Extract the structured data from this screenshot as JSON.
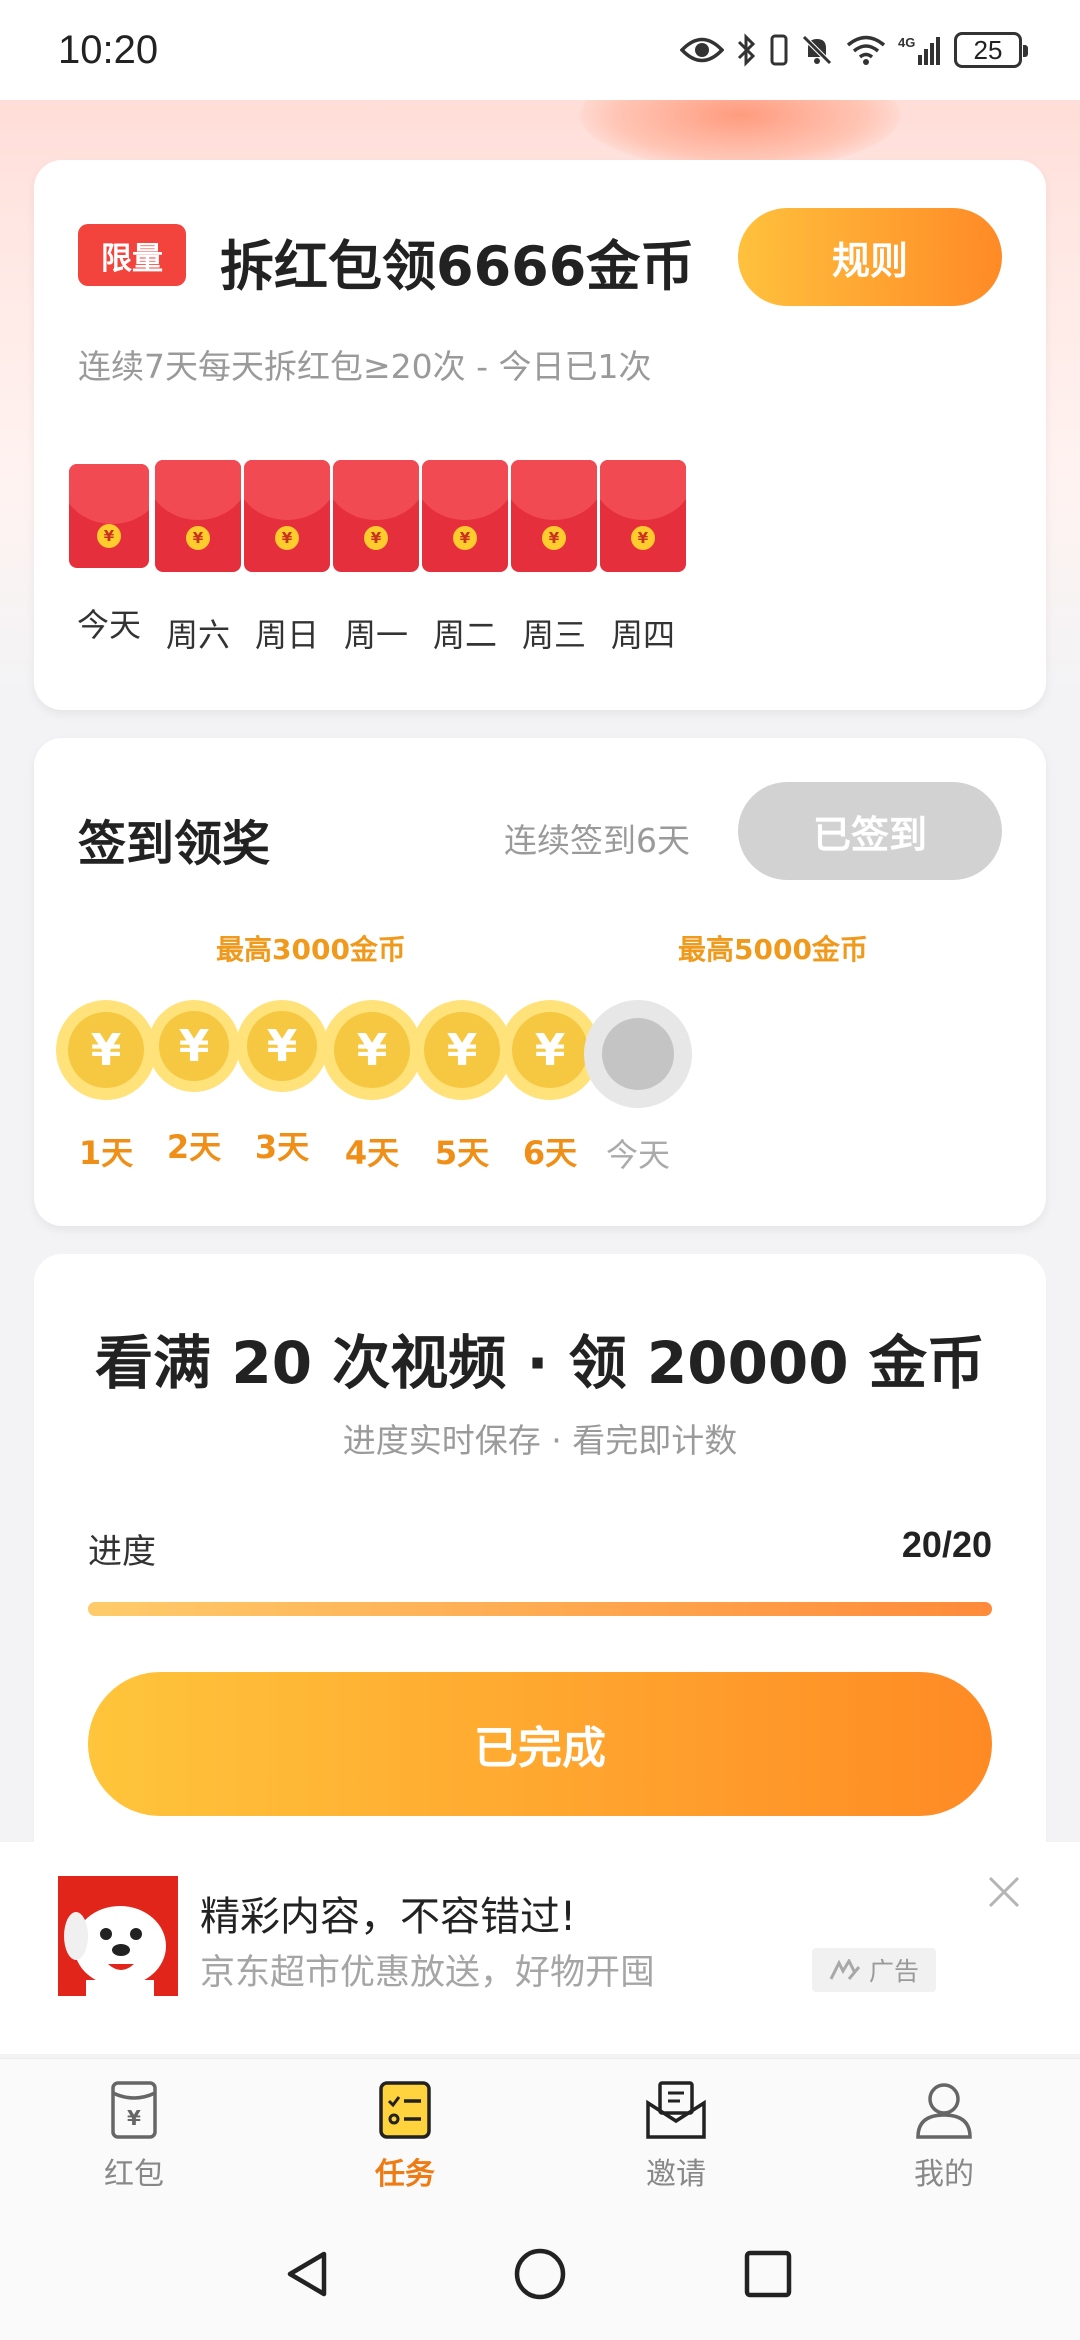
{
  "status_bar": {
    "time": "10:20",
    "battery": "25",
    "network": "4G"
  },
  "red_packet_task": {
    "badge": "限量",
    "title": "拆红包领6666金币",
    "rule_button": "规则",
    "subtitle": "连续7天每天拆红包≥20次 - 今日已1次",
    "days": [
      {
        "label": "今天"
      },
      {
        "label": "周六"
      },
      {
        "label": "周日"
      },
      {
        "label": "周一"
      },
      {
        "label": "周二"
      },
      {
        "label": "周三"
      },
      {
        "label": "周四"
      }
    ],
    "coin_symbol": "¥"
  },
  "check_in": {
    "title": "签到领奖",
    "streak": "连续签到6天",
    "button": "已签到",
    "max_labels": [
      "最高3000金币",
      "最高5000金币"
    ],
    "coin_symbol": "¥",
    "days": [
      {
        "label": "1天",
        "done": true
      },
      {
        "label": "2天",
        "done": true
      },
      {
        "label": "3天",
        "done": true
      },
      {
        "label": "4天",
        "done": true
      },
      {
        "label": "5天",
        "done": true
      },
      {
        "label": "6天",
        "done": true
      },
      {
        "label": "今天",
        "done": false
      }
    ]
  },
  "video_task": {
    "title": "看满 20 次视频 · 领 20000 金币",
    "subtitle": "进度实时保存 · 看完即计数",
    "progress_label": "进度",
    "progress_text": "20/20",
    "progress_fraction": 1.0,
    "button": "已完成"
  },
  "ad": {
    "title": "精彩内容，不容错过!",
    "description": "京东超市优惠放送，好物开囤",
    "tag": "广告"
  },
  "bottom_nav": {
    "items": [
      {
        "label": "红包",
        "icon": "red-packet-icon",
        "active": false
      },
      {
        "label": "任务",
        "icon": "task-list-icon",
        "active": true
      },
      {
        "label": "邀请",
        "icon": "invite-mail-icon",
        "active": false
      },
      {
        "label": "我的",
        "icon": "profile-icon",
        "active": false
      }
    ]
  },
  "colors": {
    "accent_orange": "#ff8a26",
    "accent_yellow": "#ffc13d",
    "red": "#f2433c",
    "active_tab": "#ef7b14"
  }
}
